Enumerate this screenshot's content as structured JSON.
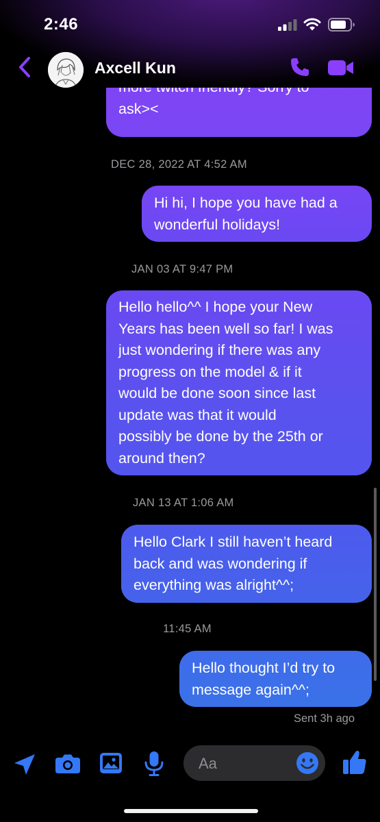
{
  "status_bar": {
    "time": "2:46"
  },
  "header": {
    "contact_name": "Axcell Kun"
  },
  "messages": [
    {
      "lines": [
        "more twitch friendly? Sorry to",
        "ask><"
      ]
    },
    {
      "lines": [
        "Hi hi, I hope you have had a",
        "wonderful holidays!"
      ]
    },
    {
      "lines": [
        "Hello hello^^ I hope your New",
        "Years has been well so far! I was",
        "just wondering if there was any",
        "progress on the model & if it",
        "would be done soon since last",
        "update was that it would",
        "possibly be done by the 25th or",
        "around then?"
      ]
    },
    {
      "lines": [
        "Hello Clark I still haven’t heard",
        "back and was wondering if",
        "everything was alright^^;"
      ]
    },
    {
      "lines": [
        "Hello thought I’d try to",
        "message again^^;"
      ]
    }
  ],
  "timestamps": [
    "DEC 28, 2022 AT 4:52 AM",
    "JAN 03 AT 9:47 PM",
    "JAN 13 AT 1:06 AM",
    "11:45 AM"
  ],
  "delivery_status": "Sent 3h ago",
  "composer": {
    "placeholder": "Aa"
  },
  "colors": {
    "accent": "#8a3ffc",
    "bubble_top": "#7b45f4",
    "bubble_mid": "#5a52ee",
    "bubble_bottom": "#3f6ee8",
    "icon_blue": "#3478f6"
  },
  "icons": [
    "back-chevron-icon",
    "phone-icon",
    "video-camera-icon",
    "location-arrow-icon",
    "camera-icon",
    "photo-icon",
    "microphone-icon",
    "emoji-icon",
    "thumbs-up-icon"
  ]
}
